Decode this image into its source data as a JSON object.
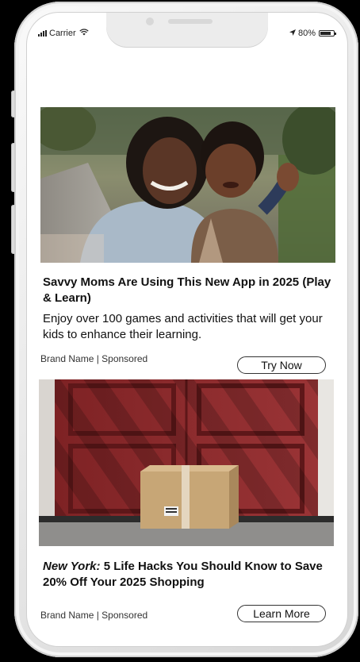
{
  "status_bar": {
    "carrier": "Carrier",
    "battery_percent": "80%",
    "battery_level": 0.8
  },
  "ads": [
    {
      "image_icon": "mother-and-child-photo",
      "title": "Savvy Moms Are Using This New App in 2025 (Play & Learn)",
      "body": "Enjoy over 100 games and activities that will get your kids to enhance their learning.",
      "meta": "Brand Name | Sponsored",
      "cta_label": "Try Now"
    },
    {
      "image_icon": "package-at-red-door-photo",
      "title_prefix": "New York:",
      "title_rest": " 5 Life Hacks You Should Know to Save 20% Off Your 2025 Shopping",
      "meta": "Brand Name | Sponsored",
      "cta_label": "Learn More"
    }
  ],
  "colors": {
    "door_red": "#8a2a2c",
    "frame": "#e9e9e9",
    "screen": "#ffffff"
  }
}
